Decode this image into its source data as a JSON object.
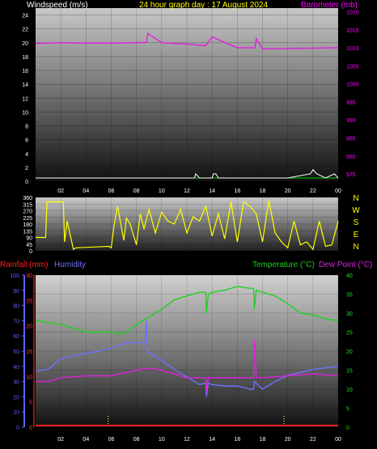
{
  "panel1": {
    "title": "24 hour graph day : 17 August 2024",
    "left_label": "Windspeed (m/s)",
    "right_label": "Barometer (mb)",
    "colors": {
      "title": "#ffff00",
      "left_label": "#ffffff",
      "right_label": "#ff00ff",
      "left_ticks": "#ffffff",
      "right_ticks": "#ff00ff",
      "barometer": "#e020e0",
      "wind": "#ffffff",
      "baseline": "#00d000"
    }
  },
  "panel2": {
    "compass": [
      "N",
      "W",
      "S",
      "E",
      "N"
    ],
    "colors": {
      "line": "#ffff00",
      "ticks": "#ffffff",
      "compass": "#ffff00"
    }
  },
  "panel3": {
    "rain_label": "Rainfall (mm)",
    "humidity_label": "Humidity",
    "temp_label": "Temperature (°C)",
    "dew_label": "Dew Point (°C)",
    "colors": {
      "rain": "#ff2020",
      "humidity": "#7070ff",
      "temp": "#20d020",
      "dew": "#e020e0",
      "rain_axis": "#ff4040",
      "humidity_axis": "#6060ff",
      "temp_axis": "#20e020"
    }
  },
  "chart_data": [
    {
      "type": "line",
      "id": "wind-baro",
      "title": "24 hour graph day : 17 August 2024",
      "x_ticks": [
        "02",
        "04",
        "06",
        "08",
        "10",
        "12",
        "14",
        "16",
        "18",
        "20",
        "22",
        "00"
      ],
      "y_left": {
        "label": "Windspeed (m/s)",
        "range": [
          0,
          25
        ],
        "ticks": [
          0,
          2,
          4,
          6,
          8,
          10,
          12,
          14,
          16,
          18,
          20,
          22,
          24
        ]
      },
      "y_right": {
        "label": "Barometer (mb)",
        "range": [
          973,
          1021
        ],
        "ticks": [
          975,
          980,
          985,
          990,
          995,
          1000,
          1005,
          1010,
          1015,
          1020
        ]
      },
      "series": [
        {
          "name": "Barometer (mb)",
          "axis": "right",
          "x": [
            0,
            2,
            4,
            6,
            8,
            8.8,
            8.9,
            10,
            12,
            13.5,
            14,
            16,
            17.4,
            17.5,
            18,
            20,
            22,
            24
          ],
          "values": [
            1011.2,
            1011.4,
            1011.3,
            1011.3,
            1011.4,
            1011.5,
            1014,
            1011.4,
            1011.0,
            1010.6,
            1013,
            1010.0,
            1010.0,
            1012.5,
            1009.7,
            1009.8,
            1009.9,
            1010.0
          ]
        },
        {
          "name": "Windspeed (m/s)",
          "axis": "left",
          "x": [
            0,
            12,
            12.6,
            12.7,
            13,
            14,
            14.1,
            14.3,
            14.5,
            20,
            21.8,
            22,
            22.3,
            23,
            23.7,
            24
          ],
          "values": [
            0,
            0,
            0,
            0.6,
            0,
            0,
            0.6,
            0.6,
            0,
            0,
            0.6,
            1.2,
            0.6,
            0,
            0.6,
            0
          ]
        }
      ]
    },
    {
      "type": "line",
      "id": "wind-direction",
      "y_left": {
        "range": [
          0,
          360
        ],
        "ticks": [
          0,
          45,
          90,
          135,
          180,
          225,
          270,
          315,
          360
        ]
      },
      "series": [
        {
          "name": "Wind direction",
          "x": [
            0,
            0.8,
            0.9,
            2.2,
            2.3,
            2.5,
            3.0,
            3.2,
            5.8,
            6.0,
            6.2,
            6.5,
            7.0,
            7.2,
            7.5,
            8.0,
            8.3,
            8.6,
            9.0,
            9.5,
            10.0,
            10.5,
            11.0,
            11.5,
            12.0,
            12.5,
            13.0,
            13.5,
            14.0,
            14.5,
            15.0,
            15.5,
            16.0,
            16.5,
            17.0,
            17.5,
            18.0,
            18.5,
            19.0,
            19.5,
            20.0,
            20.5,
            21.0,
            21.5,
            22.0,
            22.5,
            23.0,
            23.5,
            24.0
          ],
          "values": [
            90,
            90,
            330,
            330,
            60,
            200,
            10,
            20,
            30,
            20,
            160,
            300,
            70,
            220,
            180,
            40,
            250,
            150,
            280,
            120,
            260,
            200,
            180,
            280,
            120,
            230,
            200,
            300,
            100,
            250,
            80,
            330,
            60,
            330,
            300,
            250,
            60,
            340,
            120,
            60,
            20,
            200,
            40,
            60,
            10,
            200,
            30,
            40,
            200
          ]
        }
      ]
    },
    {
      "type": "line",
      "id": "temp-hum-rain",
      "y_left_rain": {
        "label": "Rainfall (mm)",
        "range": [
          0,
          30
        ],
        "ticks": [
          0,
          5,
          10,
          15,
          20,
          25,
          30
        ]
      },
      "y_left_humidity": {
        "label": "Humidity",
        "range": [
          0,
          100
        ],
        "ticks": [
          0,
          10,
          20,
          30,
          40,
          50,
          60,
          70,
          80,
          90,
          100
        ]
      },
      "y_right": {
        "label": "Temperature (°C)",
        "range": [
          0,
          40
        ],
        "ticks": [
          0,
          5,
          10,
          15,
          20,
          25,
          30,
          35,
          40
        ]
      },
      "x_ticks": [
        "02",
        "04",
        "06",
        "08",
        "10",
        "12",
        "14",
        "16",
        "18",
        "20",
        "22",
        "00"
      ],
      "series": [
        {
          "name": "Temperature (°C)",
          "axis": "right",
          "x": [
            0,
            2,
            4,
            6,
            7,
            8,
            9,
            10,
            11,
            12,
            13,
            13.5,
            13.55,
            13.7,
            14,
            15,
            16,
            17,
            17.3,
            17.35,
            17.5,
            18,
            19,
            20,
            21,
            22,
            23,
            24
          ],
          "values": [
            28,
            27,
            25,
            25,
            24.5,
            27,
            29,
            31,
            33.5,
            34.5,
            35.5,
            35.5,
            30,
            35,
            35.5,
            36,
            37,
            36.5,
            36.5,
            31,
            36,
            35.5,
            34.5,
            32.5,
            30,
            29.5,
            28.5,
            28
          ]
        },
        {
          "name": "Humidity",
          "axis": "left_humidity",
          "x": [
            0,
            1,
            2,
            3,
            5,
            6,
            7,
            8,
            8.7,
            8.8,
            8.85,
            9.0,
            10,
            11,
            12,
            13,
            13.5,
            13.55,
            13.7,
            14,
            15,
            16,
            17,
            17.3,
            17.35,
            18,
            19,
            20,
            21,
            22,
            23,
            24
          ],
          "values": [
            37,
            38,
            45,
            47,
            50,
            52,
            55,
            56,
            55,
            70,
            50,
            49,
            44,
            38,
            33,
            28,
            29,
            20,
            29,
            28,
            27,
            27,
            25,
            25,
            30,
            25,
            30,
            34,
            36,
            38,
            39,
            40
          ]
        },
        {
          "name": "Dew Point (°C)",
          "axis": "right",
          "x": [
            0,
            1,
            2,
            4,
            6,
            8,
            9,
            10,
            11,
            12,
            13,
            13.5,
            13.55,
            13.7,
            14,
            15,
            16,
            17,
            17.3,
            17.35,
            17.5,
            18,
            20,
            22,
            24
          ],
          "values": [
            12,
            12,
            13,
            13.5,
            13.5,
            15,
            15.5,
            15,
            14,
            13,
            13,
            13,
            9.5,
            13,
            13,
            13,
            13,
            13,
            13,
            23,
            13,
            13,
            13.5,
            14,
            13.5
          ]
        },
        {
          "name": "Rainfall (mm)",
          "axis": "left_rain",
          "x": [
            0,
            24
          ],
          "values": [
            0,
            0
          ]
        }
      ]
    }
  ]
}
